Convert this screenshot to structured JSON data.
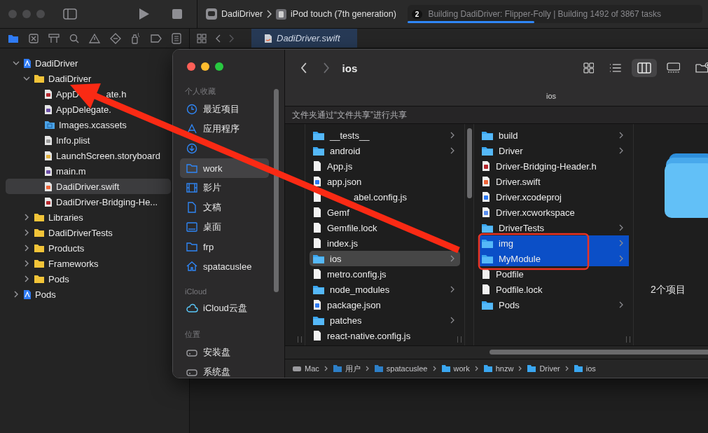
{
  "xcode": {
    "scheme": "DadiDriver",
    "device": "iPod touch (7th generation)",
    "activity": {
      "badge": "2",
      "status": "Building DadiDriver: Flipper-Folly | Building 1492 of 3867 tasks",
      "level": 0.43
    },
    "editor_tab": {
      "label": "DadiDriver.swift",
      "selected": true
    },
    "navigator": [
      {
        "label": "DadiDriver",
        "kind": "project",
        "selected": false,
        "expanded": true,
        "children": [
          {
            "label": "DadiDriver",
            "kind": "folder",
            "selected": false,
            "expanded": true,
            "children": [
              {
                "label": "AppD",
                "label_tail": "ate.h",
                "kind": "header",
                "selected": false
              },
              {
                "label": "AppDelegate.",
                "kind": "objc",
                "selected": false
              },
              {
                "label": "Images.xcassets",
                "kind": "xcassets",
                "selected": false
              },
              {
                "label": "Info.plist",
                "kind": "plist",
                "selected": false
              },
              {
                "label": "LaunchScreen.storyboard",
                "kind": "storyboard",
                "selected": false
              },
              {
                "label": "main.m",
                "kind": "objc",
                "selected": false
              },
              {
                "label": "DadiDriver.swift",
                "kind": "swift",
                "selected": true
              },
              {
                "label": "DadiDriver-Bridging-He...",
                "kind": "header",
                "selected": false
              }
            ]
          },
          {
            "label": "Libraries",
            "kind": "folder",
            "selected": false,
            "expanded": false
          },
          {
            "label": "DadiDriverTests",
            "kind": "folder",
            "selected": false,
            "expanded": false
          },
          {
            "label": "Products",
            "kind": "folder",
            "selected": false,
            "expanded": false
          },
          {
            "label": "Frameworks",
            "kind": "folder",
            "selected": false,
            "expanded": false
          },
          {
            "label": "Pods",
            "kind": "folder",
            "selected": false,
            "expanded": false
          }
        ]
      },
      {
        "label": "Pods",
        "kind": "project",
        "selected": false,
        "expanded": false
      }
    ]
  },
  "finder": {
    "title": "ios",
    "tab_title": "ios",
    "banner": "文件夹通过“文件共享”进行共享",
    "sidebar": [
      {
        "heading": "个人收藏",
        "items": [
          {
            "label": "最近项目",
            "kind": "clock",
            "selected": false
          },
          {
            "label": "应用程序",
            "kind": "apps",
            "selected": false
          },
          {
            "kind": "download",
            "selected": false
          },
          {
            "label": "work",
            "kind": "folder",
            "selected": true
          },
          {
            "label": "影片",
            "kind": "film",
            "selected": false
          },
          {
            "label": "文稿",
            "kind": "doc",
            "selected": false
          },
          {
            "label": "桌面",
            "kind": "desktop",
            "selected": false
          },
          {
            "label": "frp",
            "kind": "folder",
            "selected": false
          },
          {
            "label": "spatacuslee",
            "kind": "home",
            "selected": false
          }
        ]
      },
      {
        "heading": "iCloud",
        "items": [
          {
            "label": "iCloud云盘",
            "kind": "cloud",
            "selected": false
          }
        ]
      },
      {
        "heading": "位置",
        "items": [
          {
            "label": "安装盘",
            "kind": "disk",
            "selected": false
          },
          {
            "label": "系统盘",
            "kind": "disk",
            "selected": false
          }
        ]
      }
    ],
    "columns": [
      [
        {
          "name": "__tests__",
          "kind": "folder",
          "selected": false
        },
        {
          "name": "android",
          "kind": "folder",
          "selected": false
        },
        {
          "name": "App.js",
          "kind": "file",
          "selected": false
        },
        {
          "name": "app.json",
          "kind": "json",
          "selected": false
        },
        {
          "name": "abel.config.js",
          "kind": "file",
          "selected": false,
          "covered": true
        },
        {
          "name": "Gemf",
          "kind": "file",
          "selected": false
        },
        {
          "name": "Gemfile.lock",
          "kind": "file",
          "selected": false
        },
        {
          "name": "index.js",
          "kind": "file",
          "selected": false
        },
        {
          "name": "ios",
          "kind": "folder",
          "selected": true
        },
        {
          "name": "metro.config.js",
          "kind": "file",
          "selected": false
        },
        {
          "name": "node_modules",
          "kind": "folder",
          "selected": false
        },
        {
          "name": "package.json",
          "kind": "json",
          "selected": false
        },
        {
          "name": "patches",
          "kind": "folder",
          "selected": false
        },
        {
          "name": "react-native.config.js",
          "kind": "file",
          "selected": false
        }
      ],
      [
        {
          "name": "build",
          "kind": "folder",
          "selected": false
        },
        {
          "name": "Driver",
          "kind": "folder",
          "selected": false
        },
        {
          "name": "Driver-Bridging-Header.h",
          "kind": "header",
          "selected": false
        },
        {
          "name": "Driver.swift",
          "kind": "swift",
          "selected": false
        },
        {
          "name": "Driver.xcodeproj",
          "kind": "xcodeproj",
          "selected": false
        },
        {
          "name": "Driver.xcworkspace",
          "kind": "xcworkspace",
          "selected": false
        },
        {
          "name": "DriverTests",
          "kind": "folder",
          "selected": false
        },
        {
          "name": "img",
          "kind": "folder",
          "selected": true
        },
        {
          "name": "MyModule",
          "kind": "folder",
          "selected": true
        },
        {
          "name": "Podfile",
          "kind": "file",
          "selected": false
        },
        {
          "name": "Podfile.lock",
          "kind": "file",
          "selected": false
        },
        {
          "name": "Pods",
          "kind": "folder",
          "selected": false
        }
      ]
    ],
    "preview_count": "2个项目",
    "path": [
      {
        "label": "Mac",
        "kind": "disk"
      },
      {
        "label": "用户",
        "kind": "users"
      },
      {
        "label": "spatacuslee",
        "kind": "home"
      },
      {
        "label": "work",
        "kind": "folder"
      },
      {
        "label": "hnzw",
        "kind": "folder"
      },
      {
        "label": "Driver",
        "kind": "folder"
      },
      {
        "label": "ios",
        "kind": "folder"
      }
    ]
  }
}
